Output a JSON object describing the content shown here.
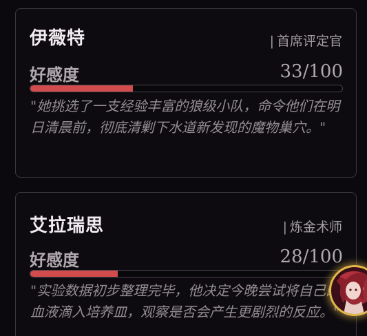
{
  "cards": [
    {
      "name": "伊薇特",
      "role_separator": "|",
      "role": "首席评定官",
      "affection_label": "好感度",
      "affection_text": "33/100",
      "affection_value": 33,
      "affection_max": 100,
      "quote": "\"她挑选了一支经验丰富的狼级小队，命令他们在明日清晨前，彻底清剿下水道新发现的魔物巢穴。\""
    },
    {
      "name": "艾拉瑞思",
      "role_separator": "|",
      "role": "炼金术师",
      "affection_label": "好感度",
      "affection_text": "28/100",
      "affection_value": 28,
      "affection_max": 100,
      "quote": "\"实验数据初步整理完毕，他决定今晚尝试将自己的血液滴入培养皿，观察是否会产生更剧烈的反应。\""
    }
  ],
  "colors": {
    "accent": "#d24b4d",
    "avatar_ring": "#e2b84a"
  }
}
